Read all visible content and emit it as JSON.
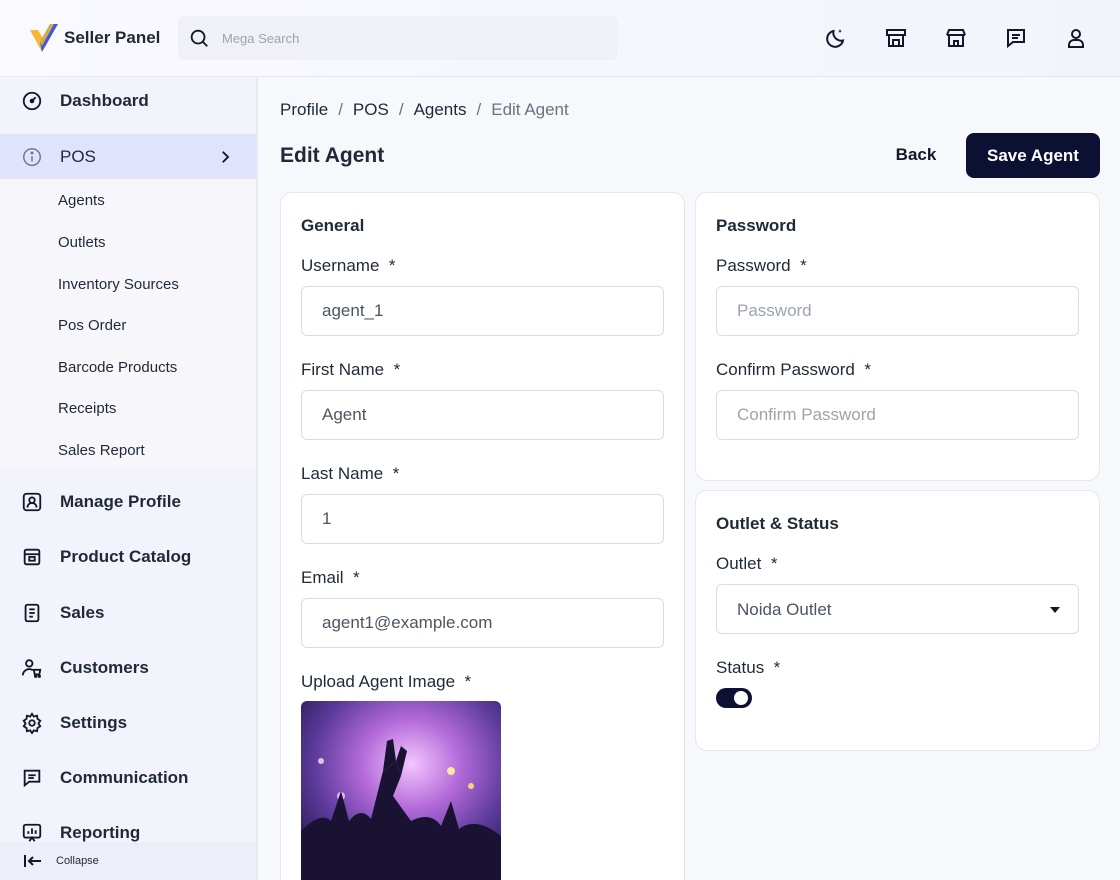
{
  "header": {
    "brand": "Seller Panel",
    "search_placeholder": "Mega Search",
    "icons": [
      "moon-icon",
      "store-icon",
      "shop-icon",
      "message-icon",
      "user-icon"
    ]
  },
  "sidebar": {
    "items": [
      {
        "label": "Dashboard",
        "icon": "dashboard-icon"
      },
      {
        "label": "POS",
        "icon": "info-icon"
      },
      {
        "label": "Manage Profile",
        "icon": "profile-icon"
      },
      {
        "label": "Product Catalog",
        "icon": "catalog-icon"
      },
      {
        "label": "Sales",
        "icon": "sales-icon"
      },
      {
        "label": "Customers",
        "icon": "customers-icon"
      },
      {
        "label": "Settings",
        "icon": "gear-icon"
      },
      {
        "label": "Communication",
        "icon": "chat-icon"
      },
      {
        "label": "Reporting",
        "icon": "reporting-icon"
      }
    ],
    "pos_sub_items": [
      "Agents",
      "Outlets",
      "Inventory Sources",
      "Pos Order",
      "Barcode Products",
      "Receipts",
      "Sales Report"
    ],
    "collapse_label": "Collapse"
  },
  "breadcrumb": [
    "Profile",
    "POS",
    "Agents",
    "Edit Agent"
  ],
  "page": {
    "title": "Edit Agent",
    "back_label": "Back",
    "save_label": "Save Agent"
  },
  "general": {
    "title": "General",
    "username": {
      "label": "Username",
      "value": "agent_1"
    },
    "first_name": {
      "label": "First Name",
      "value": "Agent"
    },
    "last_name": {
      "label": "Last Name",
      "value": "1"
    },
    "email": {
      "label": "Email",
      "value": "agent1@example.com"
    },
    "image_label": "Upload Agent Image",
    "required_mark": "*"
  },
  "password": {
    "title": "Password",
    "password": {
      "label": "Password",
      "placeholder": "Password"
    },
    "confirm": {
      "label": "Confirm Password",
      "placeholder": "Confirm Password"
    }
  },
  "outlet_status": {
    "title": "Outlet & Status",
    "outlet_label": "Outlet",
    "outlet_value": "Noida Outlet",
    "status_label": "Status",
    "status_on": true
  },
  "colors": {
    "primary": "#0c1033",
    "active_nav": "#dfe3fb",
    "logo_yellow": "#f5b82e",
    "logo_blue": "#3b5bdb"
  }
}
